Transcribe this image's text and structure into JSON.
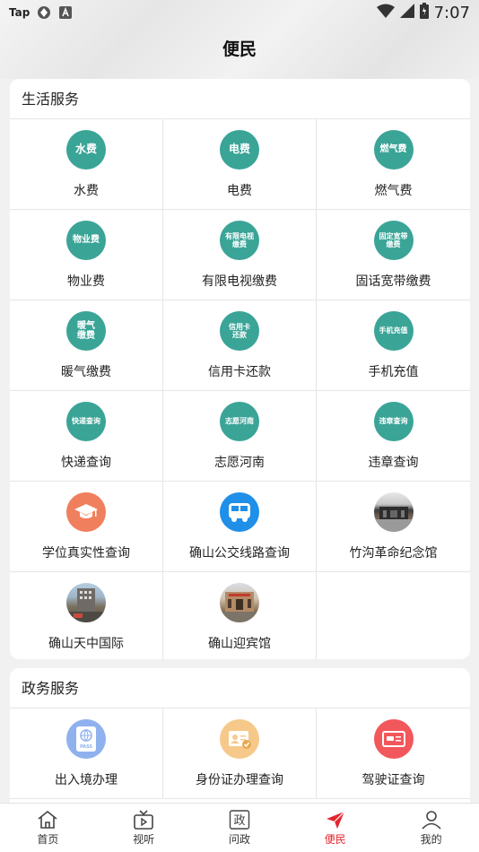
{
  "status_bar": {
    "carrier_label": "Tap",
    "time": "7:07"
  },
  "header": {
    "title": "便民"
  },
  "life_services": {
    "title": "生活服务",
    "items": [
      {
        "label": "水费",
        "icon_text": "水费",
        "icon": "teal-text"
      },
      {
        "label": "电费",
        "icon_text": "电费",
        "icon": "teal-text"
      },
      {
        "label": "燃气费",
        "icon_text": "燃气费",
        "icon": "teal-text"
      },
      {
        "label": "物业费",
        "icon_text": "物业费",
        "icon": "teal-text"
      },
      {
        "label": "有限电视缴费",
        "icon_text": "有限电视缴费",
        "icon": "teal-text"
      },
      {
        "label": "固话宽带缴费",
        "icon_text": "固定宽带缴费",
        "icon": "teal-text"
      },
      {
        "label": "暖气缴费",
        "icon_text": "暖气缴费",
        "icon": "teal-text"
      },
      {
        "label": "信用卡还款",
        "icon_text": "信用卡还款",
        "icon": "teal-text"
      },
      {
        "label": "手机充值",
        "icon_text": "手机充值",
        "icon": "teal-text"
      },
      {
        "label": "快递查询",
        "icon_text": "快递查询",
        "icon": "teal-text"
      },
      {
        "label": "志愿河南",
        "icon_text": "志愿河南",
        "icon": "teal-text"
      },
      {
        "label": "违章查询",
        "icon_text": "违章查询",
        "icon": "teal-text"
      },
      {
        "label": "学位真实性查询",
        "icon": "graduation-cap-icon"
      },
      {
        "label": "确山公交线路查询",
        "icon": "bus-icon"
      },
      {
        "label": "竹沟革命纪念馆",
        "icon": "memorial-photo"
      },
      {
        "label": "确山天中国际",
        "icon": "building-photo"
      },
      {
        "label": "确山迎宾馆",
        "icon": "hotel-photo"
      }
    ]
  },
  "gov_services": {
    "title": "政务服务",
    "items": [
      {
        "label": "出入境办理",
        "icon": "passport-icon",
        "icon_text": "PASS"
      },
      {
        "label": "身份证办理查询",
        "icon": "id-card-icon"
      },
      {
        "label": "驾驶证查询",
        "icon": "driver-license-icon"
      }
    ]
  },
  "bottom_nav": {
    "items": [
      {
        "label": "首页",
        "icon": "home-icon"
      },
      {
        "label": "视听",
        "icon": "tv-icon"
      },
      {
        "label": "问政",
        "icon": "gov-icon",
        "icon_text": "政"
      },
      {
        "label": "便民",
        "icon": "send-icon"
      },
      {
        "label": "我的",
        "icon": "user-icon"
      }
    ]
  },
  "colors": {
    "teal": "#3aa497",
    "active": "#e2262d",
    "orange": "#f07f5d",
    "blue": "#1f8fe8"
  }
}
